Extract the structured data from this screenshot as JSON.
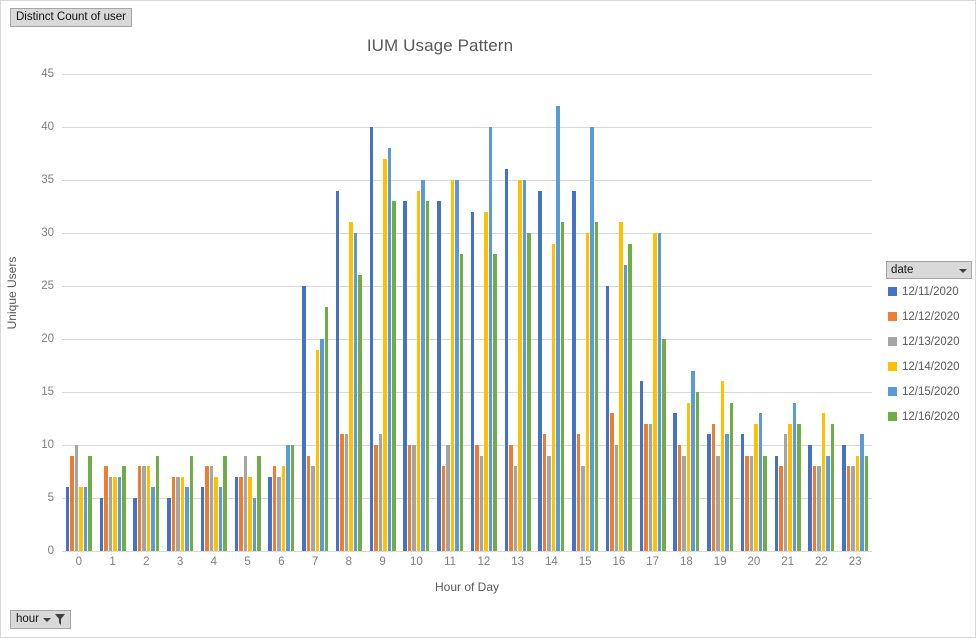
{
  "value_field_button": {
    "label": "Distinct Count of user"
  },
  "hour_field_button": {
    "label": "hour",
    "caret_icon": "chevron-down-icon",
    "filter_icon": "funnel-icon"
  },
  "legend": {
    "field_label": "date",
    "caret_icon": "chevron-down-icon"
  },
  "chart_data": {
    "type": "bar",
    "title": "IUM Usage Pattern",
    "xlabel": "Hour of Day",
    "ylabel": "Unique Users",
    "ylim": [
      0,
      45
    ],
    "yticks": [
      0,
      5,
      10,
      15,
      20,
      25,
      30,
      35,
      40,
      45
    ],
    "grid": true,
    "legend_position": "right",
    "categories": [
      "0",
      "1",
      "2",
      "3",
      "4",
      "5",
      "6",
      "7",
      "8",
      "9",
      "10",
      "11",
      "12",
      "13",
      "14",
      "15",
      "16",
      "17",
      "18",
      "19",
      "20",
      "21",
      "22",
      "23"
    ],
    "series": [
      {
        "name": "12/11/2020",
        "color": "#4472c4",
        "values": [
          6,
          5,
          5,
          5,
          6,
          7,
          7,
          25,
          34,
          40,
          33,
          33,
          32,
          36,
          34,
          34,
          25,
          16,
          13,
          11,
          11,
          9,
          10,
          10
        ]
      },
      {
        "name": "12/12/2020",
        "color": "#ed7d31",
        "values": [
          9,
          8,
          8,
          7,
          8,
          7,
          8,
          9,
          11,
          10,
          10,
          8,
          10,
          10,
          11,
          11,
          13,
          12,
          10,
          12,
          9,
          8,
          8,
          8
        ]
      },
      {
        "name": "12/13/2020",
        "color": "#a5a5a5",
        "values": [
          10,
          7,
          8,
          7,
          8,
          9,
          7,
          8,
          11,
          11,
          10,
          10,
          9,
          8,
          9,
          8,
          10,
          12,
          9,
          9,
          9,
          11,
          8,
          8
        ]
      },
      {
        "name": "12/14/2020",
        "color": "#ffc000",
        "values": [
          6,
          7,
          8,
          7,
          7,
          7,
          8,
          19,
          31,
          37,
          34,
          35,
          32,
          35,
          29,
          30,
          31,
          30,
          14,
          16,
          12,
          12,
          13,
          9
        ]
      },
      {
        "name": "12/15/2020",
        "color": "#5b9bd5",
        "values": [
          6,
          7,
          6,
          6,
          6,
          5,
          10,
          20,
          30,
          38,
          35,
          35,
          40,
          35,
          42,
          40,
          27,
          30,
          17,
          11,
          13,
          14,
          9,
          11
        ]
      },
      {
        "name": "12/16/2020",
        "color": "#70ad47",
        "values": [
          9,
          8,
          9,
          9,
          9,
          9,
          10,
          23,
          26,
          33,
          33,
          28,
          28,
          30,
          31,
          31,
          29,
          20,
          15,
          14,
          9,
          12,
          12,
          9
        ]
      }
    ]
  }
}
